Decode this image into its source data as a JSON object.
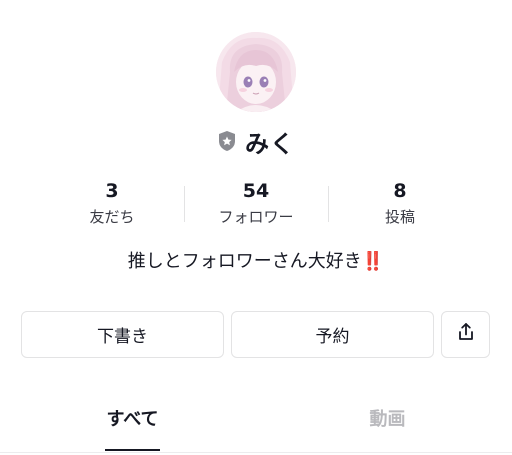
{
  "profile": {
    "name": "みく",
    "bio_text": "推しとフォロワーさん大好き",
    "bio_emoji": "‼️"
  },
  "stats": [
    {
      "value": "3",
      "label": "友だち"
    },
    {
      "value": "54",
      "label": "フォロワー"
    },
    {
      "value": "8",
      "label": "投稿"
    }
  ],
  "buttons": {
    "draft_label": "下書き",
    "reserve_label": "予約",
    "share_icon": "share-icon"
  },
  "tabs": [
    {
      "label": "すべて",
      "active": true
    },
    {
      "label": "動画",
      "active": false
    }
  ],
  "colors": {
    "text": "#161823",
    "muted": "#b9b9bd",
    "border": "#e3e3e4",
    "accent": "#e8173f"
  }
}
